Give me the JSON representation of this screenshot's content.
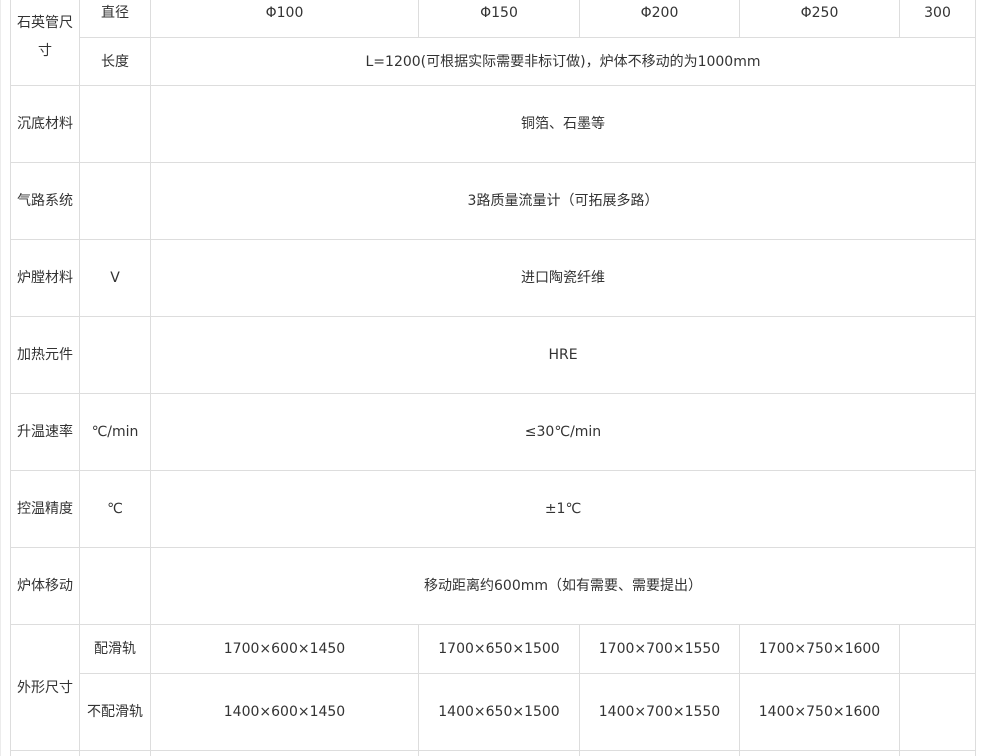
{
  "quartz_tube": {
    "category": "石英管尺寸",
    "diameter": {
      "label": "直径",
      "values": [
        "Φ100",
        "Φ150",
        "Φ200",
        "Φ250",
        "300"
      ]
    },
    "length": {
      "label": "长度",
      "value": "L=1200(可根据实际需要非标订做)，炉体不移动的为1000mm"
    }
  },
  "rows": [
    {
      "category": "沉底材料",
      "unit": "",
      "value": "铜箔、石墨等"
    },
    {
      "category": "气路系统",
      "unit": "",
      "value": "3路质量流量计（可拓展多路）"
    },
    {
      "category": "炉膛材料",
      "unit": "V",
      "value": "进口陶瓷纤维"
    },
    {
      "category": "加热元件",
      "unit": "",
      "value": "HRE"
    },
    {
      "category": "升温速率",
      "unit": "℃/min",
      "value": "≤30℃/min"
    },
    {
      "category": "控温精度",
      "unit": "℃",
      "value": "±1℃"
    },
    {
      "category": "炉体移动",
      "unit": "",
      "value": "移动距离约600mm（如有需要、需要提出）"
    }
  ],
  "dimensions": {
    "category": "外形尺寸",
    "with_rail": {
      "label": "配滑轨",
      "values": [
        "1700×600×1450",
        "1700×650×1500",
        "1700×700×1550",
        "1700×750×1600",
        ""
      ]
    },
    "without_rail": {
      "label": "不配滑轨",
      "values": [
        "1400×600×1450",
        "1400×650×1500",
        "1400×700×1550",
        "1400×750×1600",
        ""
      ]
    }
  }
}
